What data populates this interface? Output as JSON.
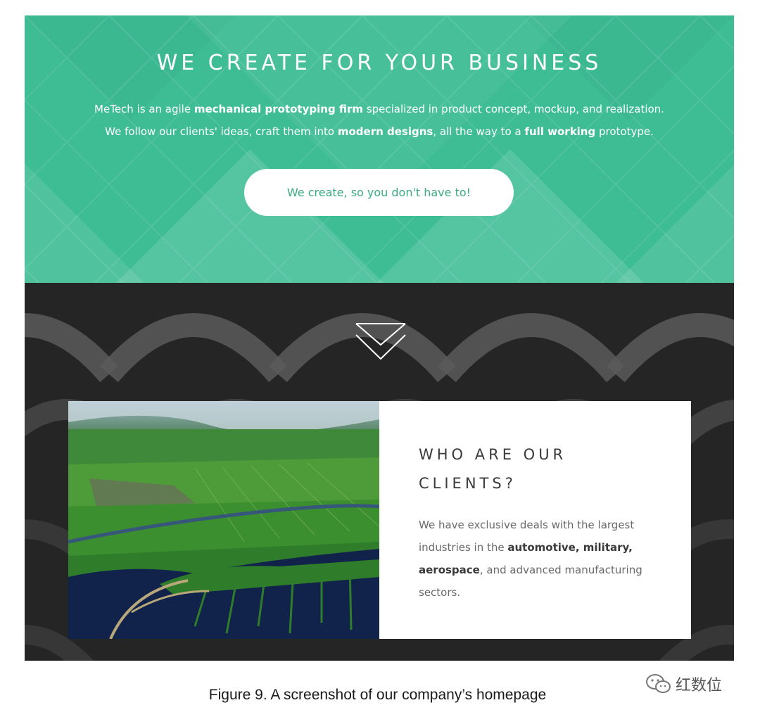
{
  "hero": {
    "title": "WE CREATE FOR YOUR BUSINESS",
    "lead_line1": [
      {
        "text": "MeTech is an agile ",
        "bold": false
      },
      {
        "text": "mechanical prototyping firm",
        "bold": true
      },
      {
        "text": " specialized in product concept, mockup, and realization.",
        "bold": false
      }
    ],
    "lead_line2": [
      {
        "text": "We follow our clients' ideas, craft them into ",
        "bold": false
      },
      {
        "text": "modern designs",
        "bold": true
      },
      {
        "text": ", all the way to a ",
        "bold": false
      },
      {
        "text": "full working",
        "bold": true
      },
      {
        "text": " prototype.",
        "bold": false
      }
    ],
    "cta_label": "We create, so you don't have to!",
    "accent_color": "#3ebc94"
  },
  "scroll_indicator": {
    "icon": "double-chevron-down-icon"
  },
  "clients": {
    "heading_line1": "WHO ARE OUR",
    "heading_line2": "CLIENTS?",
    "body": [
      {
        "text": "We have exclusive deals with the largest industries in the ",
        "bold": false
      },
      {
        "text": "automotive, military, aerospace",
        "bold": true
      },
      {
        "text": ", and advanced manufacturing sectors.",
        "bold": false
      }
    ],
    "image": "aerial-landscape-photo"
  },
  "caption": "Figure 9. A screenshot of our company’s homepage",
  "watermark": {
    "icon": "wechat-icon",
    "text": "红数位"
  }
}
